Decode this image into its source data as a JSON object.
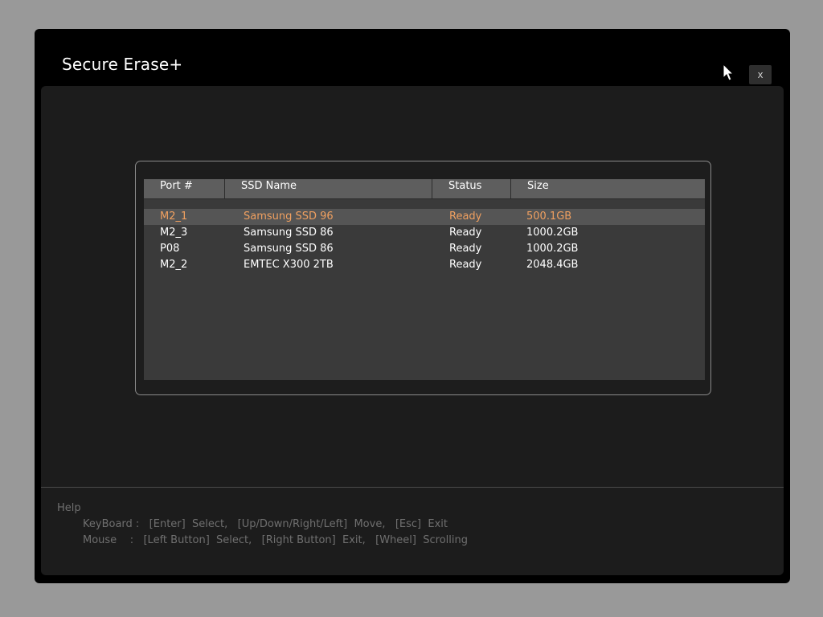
{
  "window": {
    "title": "Secure Erase+",
    "close_label": "x"
  },
  "table": {
    "headers": [
      "Port #",
      "SSD Name",
      "Status",
      "Size"
    ],
    "rows": [
      {
        "port": "M2_1",
        "name": "Samsung SSD 96",
        "status": "Ready",
        "size": "500.1GB",
        "selected": true
      },
      {
        "port": "M2_3",
        "name": "Samsung SSD 86",
        "status": "Ready",
        "size": "1000.2GB",
        "selected": false
      },
      {
        "port": "P08",
        "name": "Samsung SSD 86",
        "status": "Ready",
        "size": "1000.2GB",
        "selected": false
      },
      {
        "port": "M2_2",
        "name": "EMTEC X300 2TB",
        "status": "Ready",
        "size": "2048.4GB",
        "selected": false
      }
    ]
  },
  "help": {
    "title": "Help",
    "keyboard": "KeyBoard :   [Enter]  Select,   [Up/Down/Right/Left]  Move,   [Esc]  Exit",
    "mouse": "Mouse    :   [Left Button]  Select,   [Right Button]  Exit,   [Wheel]  Scrolling"
  },
  "colors": {
    "selected_text": "#f0a060",
    "background": "#999999"
  },
  "icons": {
    "cursor": "mouse-pointer-icon"
  }
}
